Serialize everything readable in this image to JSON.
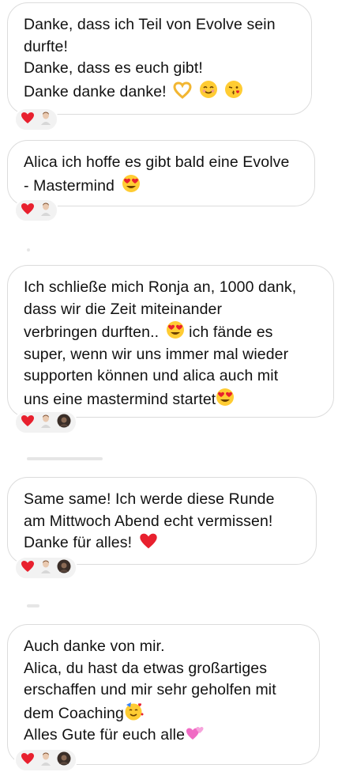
{
  "messages": [
    {
      "lines": [
        "Danke, dass ich Teil von Evolve sein",
        "durfte!",
        "Danke, dass es euch gibt!",
        "Danke danke danke!"
      ],
      "emoji": [
        "heart-hands-emoji",
        "smiling-face-emoji",
        "kiss-face-emoji"
      ],
      "reactions": [
        "red-heart",
        "avatar-light"
      ]
    },
    {
      "lines": [
        "Alica ich hoffe es gibt bald eine Evolve",
        "- Mastermind"
      ],
      "emoji": [
        "heart-eyes-emoji"
      ],
      "reactions": [
        "red-heart",
        "avatar-light"
      ]
    },
    {
      "lines": [
        "Ich schließe mich Ronja an, 1000 dank,",
        "dass wir die Zeit miteinander",
        "verbringen durften..",
        "ich fände es",
        "super, wenn wir uns immer mal wieder",
        "supporten können und alica auch mit",
        "uns eine mastermind startet"
      ],
      "emoji": [
        "heart-eyes-emoji",
        "heart-eyes-emoji"
      ],
      "reactions": [
        "red-heart",
        "avatar-light",
        "avatar-dark"
      ]
    },
    {
      "lines": [
        "Same same! Ich werde diese Runde",
        "am Mittwoch Abend echt vermissen!",
        "Danke für alles!"
      ],
      "emoji": [
        "red-heart-emoji"
      ],
      "reactions": [
        "red-heart",
        "avatar-light",
        "avatar-dark"
      ]
    },
    {
      "lines": [
        "Auch danke von mir.",
        "Alica, du hast da etwas großartiges",
        "erschaffen und mir sehr geholfen mit",
        "dem Coaching",
        "Alles Gute für euch alle"
      ],
      "emoji": [
        "party-face-emoji",
        "two-hearts-emoji"
      ],
      "reactions": [
        "red-heart",
        "avatar-light",
        "avatar-dark"
      ]
    }
  ],
  "colors": {
    "bubble_border": "#dcdcdc",
    "reaction_bg": "#f2f2f2",
    "heart": "#e8202e",
    "emoji_yellow": "#ffcc33"
  }
}
